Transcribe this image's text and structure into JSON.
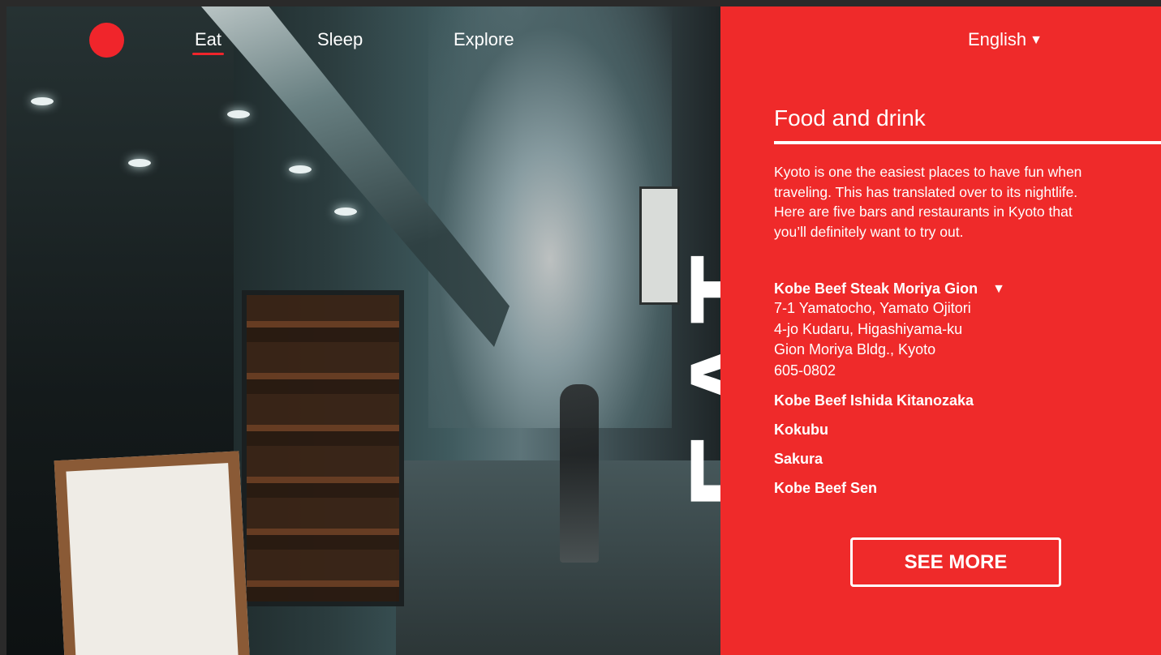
{
  "nav": {
    "logo_color": "#f0252b",
    "links": [
      {
        "label": "Eat",
        "active": true
      },
      {
        "label": "Sleep",
        "active": false
      },
      {
        "label": "Explore",
        "active": false
      }
    ]
  },
  "hero": {
    "overlay_text": "EAT"
  },
  "panel": {
    "background": "#ef2a2a",
    "language": {
      "label": "English",
      "icon": "caret-down-icon"
    },
    "section_title": "Food and drink",
    "intro": "Kyoto is one the easiest places to have fun when traveling. This has translated over to its nightlife. Here are five bars and restaurants in Kyoto that you’ll definitely want to try out.",
    "featured": {
      "name": "Kobe Beef Steak Moriya Gion",
      "expanded_icon": "caret-down-icon",
      "address_lines": [
        "7-1 Yamatocho, Yamato Ojitori",
        "4-jo Kudaru, Higashiyama-ku",
        "Gion Moriya Bldg., Kyoto",
        "605-0802"
      ]
    },
    "others": [
      "Kobe Beef Ishida Kitanozaka",
      "Kokubu",
      "Sakura",
      "Kobe Beef Sen"
    ],
    "cta_label": "SEE MORE"
  }
}
